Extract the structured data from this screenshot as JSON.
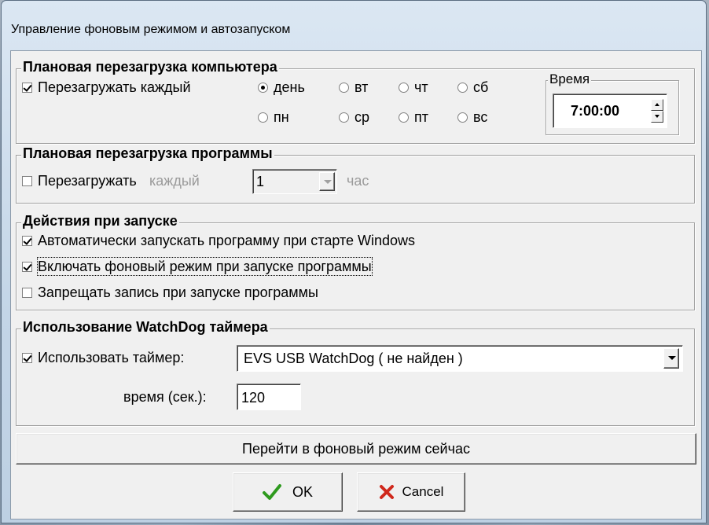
{
  "window": {
    "title": "Управление фоновым режимом и автозапуском"
  },
  "group_pc_restart": {
    "title": "Плановая перезагрузка компьютера",
    "restart_every_label": "Перезагружать каждый",
    "restart_every_checked": true,
    "days": [
      {
        "label": "день",
        "selected": true
      },
      {
        "label": "вт",
        "selected": false
      },
      {
        "label": "чт",
        "selected": false
      },
      {
        "label": "сб",
        "selected": false
      },
      {
        "label": "пн",
        "selected": false
      },
      {
        "label": "ср",
        "selected": false
      },
      {
        "label": "пт",
        "selected": false
      },
      {
        "label": "вс",
        "selected": false
      }
    ],
    "time_group_title": "Время",
    "time_value": "7:00:00"
  },
  "group_program_restart": {
    "title": "Плановая перезагрузка программы",
    "restart_label": "Перезагружать",
    "restart_checked": false,
    "every_label": "каждый",
    "hours_value": "1",
    "unit_label": "час"
  },
  "group_startup": {
    "title": "Действия при запуске",
    "options": [
      {
        "label": "Автоматически запускать программу при старте Windows",
        "checked": true
      },
      {
        "label": "Включать фоновый режим при запуске программы",
        "checked": true
      },
      {
        "label": "Запрещать запись при запуске программы",
        "checked": false
      }
    ]
  },
  "group_watchdog": {
    "title": "Использование WatchDog таймера",
    "use_timer_label": "Использовать таймер:",
    "use_timer_checked": true,
    "device_value": "EVS USB WatchDog ( не найден )",
    "time_label": "время (сек.):",
    "time_value": "120"
  },
  "buttons": {
    "background_now": "Перейти в фоновый режим сейчас",
    "ok": "OK",
    "cancel": "Cancel"
  },
  "colors": {
    "ok_check": "#2e9a1e",
    "cancel_x": "#d0281c",
    "face": "#f0f0f0"
  }
}
